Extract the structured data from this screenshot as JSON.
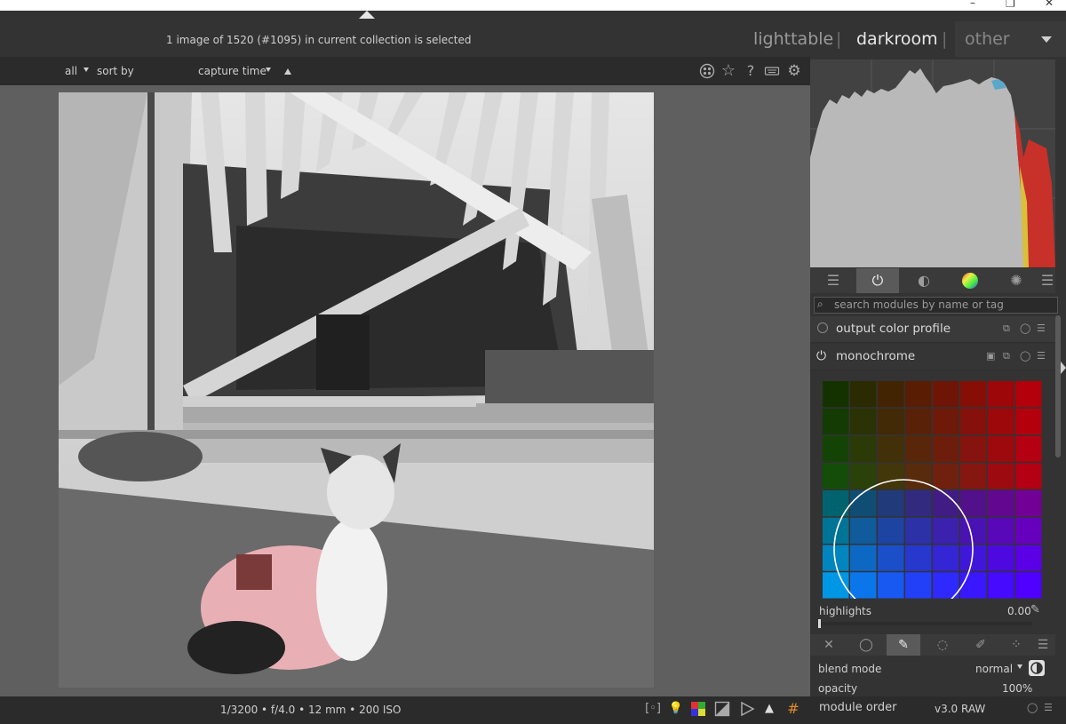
{
  "header": {
    "collection_info": "1 image of 1520 (#1095) in current collection is selected",
    "views": {
      "lighttable": "lighttable",
      "darkroom": "darkroom",
      "other": "other"
    },
    "separator": "|"
  },
  "filterbar": {
    "filter_value": "all",
    "sort_label": "sort by",
    "sort_value": "capture time"
  },
  "footer": {
    "exif": "1/3200 • f/4.0 • 12 mm • 200 ISO"
  },
  "right_panel": {
    "search_placeholder": "search modules by name or tag",
    "modules": [
      {
        "name": "output color profile",
        "enabled": false
      },
      {
        "name": "monochrome",
        "enabled": true,
        "expanded": true
      }
    ],
    "monochrome": {
      "slider_label": "highlights",
      "slider_value": "0.00"
    },
    "blend": {
      "mode_label": "blend mode",
      "mode_value": "normal",
      "opacity_label": "opacity",
      "opacity_value": "100%"
    },
    "module_order": {
      "label": "module order",
      "value": "v3.0 RAW"
    }
  },
  "colors": {
    "accent": "#e8e8e8",
    "panel_bg": "#333333",
    "center_bg": "#5f5f5f"
  }
}
